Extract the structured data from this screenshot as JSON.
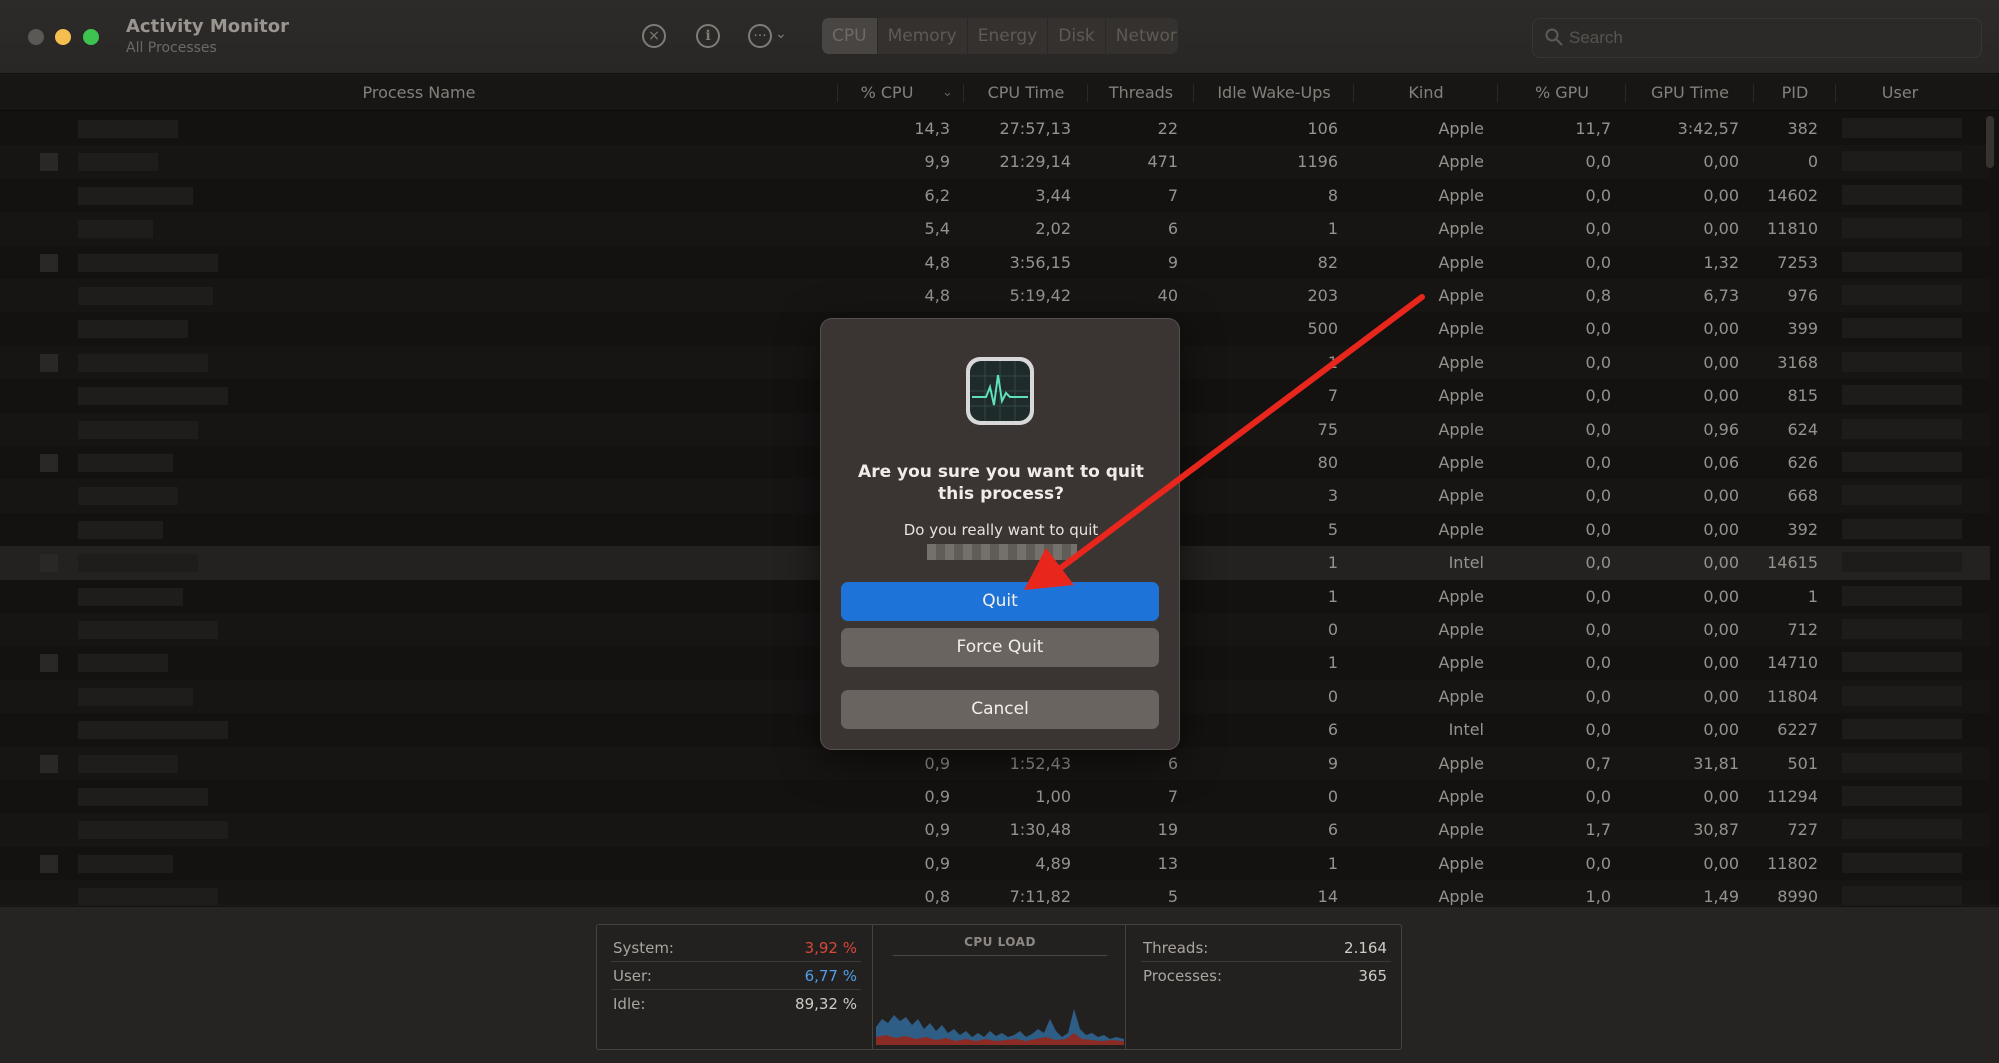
{
  "window": {
    "title": "Activity Monitor",
    "subtitle": "All Processes"
  },
  "toolbar": {
    "tabs": [
      {
        "label": "CPU",
        "active": true
      },
      {
        "label": "Memory",
        "active": false
      },
      {
        "label": "Energy",
        "active": false
      },
      {
        "label": "Disk",
        "active": false
      },
      {
        "label": "Network",
        "active": false
      }
    ],
    "search_placeholder": "Search",
    "icons": [
      "stop-icon",
      "info-icon",
      "more-icon",
      "chevron-down-icon",
      "search-icon"
    ]
  },
  "table": {
    "columns": [
      "Process Name",
      "% CPU",
      "CPU Time",
      "Threads",
      "Idle Wake-Ups",
      "Kind",
      "% GPU",
      "GPU Time",
      "PID",
      "User"
    ],
    "sort_column": "% CPU",
    "rows": [
      [
        "14,3",
        "27:57,13",
        "22",
        "106",
        "Apple",
        "11,7",
        "3:42,57",
        "382"
      ],
      [
        "9,9",
        "21:29,14",
        "471",
        "1196",
        "Apple",
        "0,0",
        "0,00",
        "0"
      ],
      [
        "6,2",
        "3,44",
        "7",
        "8",
        "Apple",
        "0,0",
        "0,00",
        "14602"
      ],
      [
        "5,4",
        "2,02",
        "6",
        "1",
        "Apple",
        "0,0",
        "0,00",
        "11810"
      ],
      [
        "4,8",
        "3:56,15",
        "9",
        "82",
        "Apple",
        "0,0",
        "1,32",
        "7253"
      ],
      [
        "4,8",
        "5:19,42",
        "40",
        "203",
        "Apple",
        "0,8",
        "6,73",
        "976"
      ],
      [
        "",
        "",
        "",
        "500",
        "Apple",
        "0,0",
        "0,00",
        "399"
      ],
      [
        "",
        "",
        "",
        "1",
        "Apple",
        "0,0",
        "0,00",
        "3168"
      ],
      [
        "",
        "",
        "",
        "7",
        "Apple",
        "0,0",
        "0,00",
        "815"
      ],
      [
        "",
        "",
        "",
        "75",
        "Apple",
        "0,0",
        "0,96",
        "624"
      ],
      [
        "",
        "",
        "",
        "80",
        "Apple",
        "0,0",
        "0,06",
        "626"
      ],
      [
        "",
        "",
        "",
        "3",
        "Apple",
        "0,0",
        "0,00",
        "668"
      ],
      [
        "",
        "",
        "",
        "5",
        "Apple",
        "0,0",
        "0,00",
        "392"
      ],
      [
        "",
        "",
        "",
        "1",
        "Intel",
        "0,0",
        "0,00",
        "14615"
      ],
      [
        "",
        "",
        "",
        "1",
        "Apple",
        "0,0",
        "0,00",
        "1"
      ],
      [
        "",
        "",
        "",
        "0",
        "Apple",
        "0,0",
        "0,00",
        "712"
      ],
      [
        "",
        "",
        "",
        "1",
        "Apple",
        "0,0",
        "0,00",
        "14710"
      ],
      [
        "",
        "",
        "",
        "0",
        "Apple",
        "0,0",
        "0,00",
        "11804"
      ],
      [
        "",
        "",
        "",
        "6",
        "Intel",
        "0,0",
        "0,00",
        "6227"
      ],
      [
        "0,9",
        "1:52,43",
        "6",
        "9",
        "Apple",
        "0,7",
        "31,81",
        "501"
      ],
      [
        "0,9",
        "1,00",
        "7",
        "0",
        "Apple",
        "0,0",
        "0,00",
        "11294"
      ],
      [
        "0,9",
        "1:30,48",
        "19",
        "6",
        "Apple",
        "1,7",
        "30,87",
        "727"
      ],
      [
        "0,9",
        "4,89",
        "13",
        "1",
        "Apple",
        "0,0",
        "0,00",
        "11802"
      ],
      [
        "0,8",
        "7:11,82",
        "5",
        "14",
        "Apple",
        "1,0",
        "1,49",
        "8990"
      ]
    ],
    "selected_row": 13
  },
  "stats": {
    "system_label": "System:",
    "system_value": "3,92 %",
    "user_label": "User:",
    "user_value": "6,77 %",
    "idle_label": "Idle:",
    "idle_value": "89,32 %",
    "graph_title": "CPU LOAD",
    "threads_label": "Threads:",
    "threads_value": "2.164",
    "processes_label": "Processes:",
    "processes_value": "365",
    "system_color": "#d9463b",
    "user_color": "#4f9ee8"
  },
  "dialog": {
    "title": "Are you sure you want to quit this process?",
    "message": "Do you really want to quit",
    "quit_label": "Quit",
    "force_quit_label": "Force Quit",
    "cancel_label": "Cancel",
    "accent": "#1e73d9"
  },
  "annotation": {
    "type": "arrow",
    "color": "#e8261c",
    "points_to": "quit-button"
  }
}
